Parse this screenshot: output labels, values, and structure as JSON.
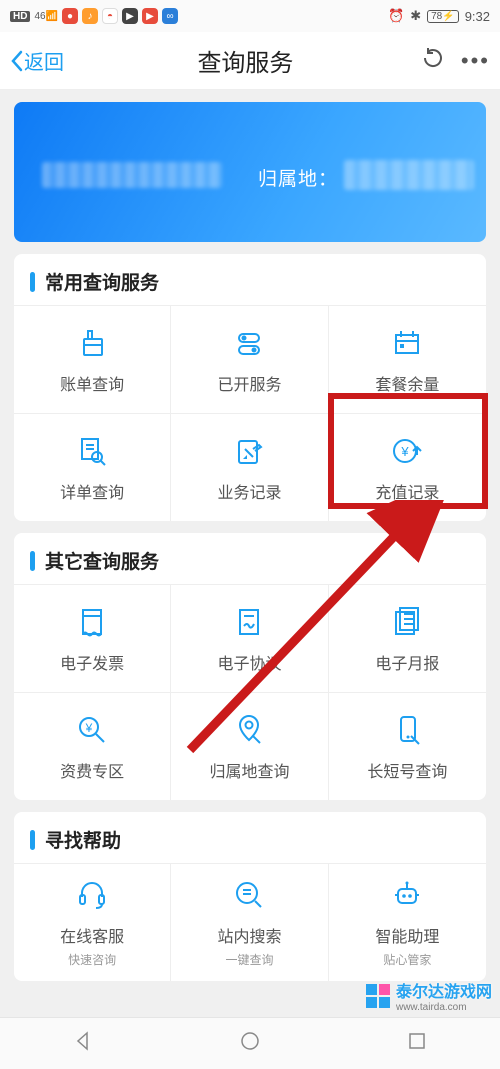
{
  "status": {
    "time": "9:32",
    "battery": "78",
    "net": "46"
  },
  "nav": {
    "back": "返回",
    "title": "查询服务"
  },
  "banner": {
    "belong_label": "归属地："
  },
  "sections": [
    {
      "title": "常用查询服务",
      "items": [
        {
          "label": "账单查询"
        },
        {
          "label": "已开服务"
        },
        {
          "label": "套餐余量"
        },
        {
          "label": "详单查询"
        },
        {
          "label": "业务记录"
        },
        {
          "label": "充值记录"
        }
      ]
    },
    {
      "title": "其它查询服务",
      "items": [
        {
          "label": "电子发票"
        },
        {
          "label": "电子协议"
        },
        {
          "label": "电子月报"
        },
        {
          "label": "资费专区"
        },
        {
          "label": "归属地查询"
        },
        {
          "label": "长短号查询"
        }
      ]
    },
    {
      "title": "寻找帮助",
      "items": [
        {
          "label": "在线客服",
          "sub": "快速咨询"
        },
        {
          "label": "站内搜索",
          "sub": "一键查询"
        },
        {
          "label": "智能助理",
          "sub": "贴心管家"
        }
      ]
    }
  ],
  "watermark": {
    "brand": "泰尔达游戏网",
    "url": "www.tairda.com"
  }
}
